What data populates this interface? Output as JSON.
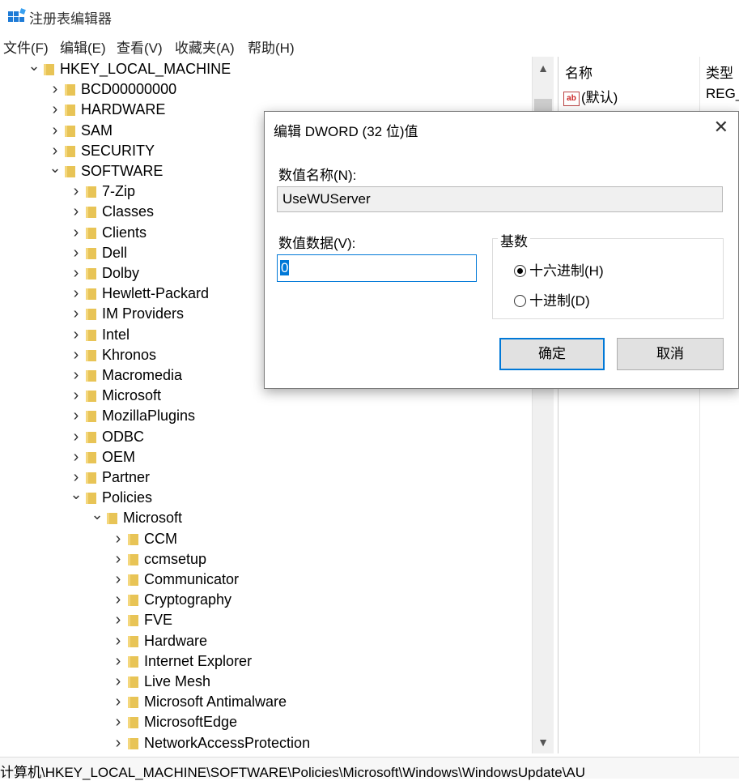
{
  "window": {
    "title": "注册表编辑器"
  },
  "menu": [
    "文件(F)",
    "编辑(E)",
    "查看(V)",
    "收藏夹(A)",
    "帮助(H)"
  ],
  "tree": [
    {
      "label": "HKEY_LOCAL_MACHINE",
      "expanded": true
    },
    {
      "label": "BCD00000000"
    },
    {
      "label": "HARDWARE"
    },
    {
      "label": "SAM"
    },
    {
      "label": "SECURITY"
    },
    {
      "label": "SOFTWARE",
      "expanded": true
    },
    {
      "label": "7-Zip"
    },
    {
      "label": "Classes"
    },
    {
      "label": "Clients"
    },
    {
      "label": "Dell"
    },
    {
      "label": "Dolby"
    },
    {
      "label": "Hewlett-Packard"
    },
    {
      "label": "IM Providers"
    },
    {
      "label": "Intel"
    },
    {
      "label": "Khronos"
    },
    {
      "label": "Macromedia"
    },
    {
      "label": "Microsoft"
    },
    {
      "label": "MozillaPlugins"
    },
    {
      "label": "ODBC"
    },
    {
      "label": "OEM"
    },
    {
      "label": "Partner"
    },
    {
      "label": "Policies",
      "expanded": true
    },
    {
      "label": "Microsoft",
      "expanded": true
    },
    {
      "label": "CCM"
    },
    {
      "label": "ccmsetup"
    },
    {
      "label": "Communicator"
    },
    {
      "label": "Cryptography"
    },
    {
      "label": "FVE"
    },
    {
      "label": "Hardware"
    },
    {
      "label": "Internet Explorer"
    },
    {
      "label": "Live Mesh"
    },
    {
      "label": "Microsoft Antimalware"
    },
    {
      "label": "MicrosoftEdge"
    },
    {
      "label": "NetworkAccessProtection"
    }
  ],
  "values_list": {
    "col_name": "名称",
    "col_type": "类型",
    "rows": [
      {
        "name": "(默认)",
        "type": "REG_",
        "icon": "ab-string-icon"
      }
    ]
  },
  "dialog": {
    "title": "编辑 DWORD (32 位)值",
    "name_label": "数值名称(N):",
    "name_value": "UseWUServer",
    "data_label": "数值数据(V):",
    "data_value": "0",
    "base_label": "基数",
    "radio_hex": "十六进制(H)",
    "radio_dec": "十进制(D)",
    "selected_base": "hex",
    "ok_label": "确定",
    "cancel_label": "取消",
    "close_glyph": "✕"
  },
  "status": {
    "path": "计算机\\HKEY_LOCAL_MACHINE\\SOFTWARE\\Policies\\Microsoft\\Windows\\WindowsUpdate\\AU"
  }
}
